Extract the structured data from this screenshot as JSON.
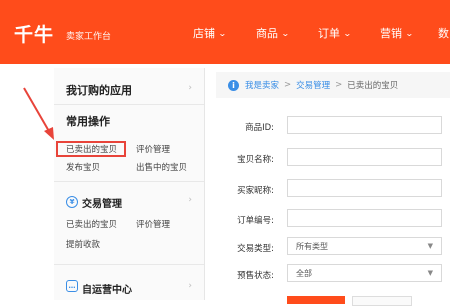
{
  "header": {
    "logo": "千牛",
    "subtitle": "卖家工作台",
    "nav": [
      {
        "label": "店铺"
      },
      {
        "label": "商品"
      },
      {
        "label": "订单"
      },
      {
        "label": "营销"
      },
      {
        "label": "数"
      }
    ]
  },
  "sidebar": {
    "my_apps": "我订购的应用",
    "common_ops": "常用操作",
    "common_links": [
      "已卖出的宝贝",
      "评价管理",
      "发布宝贝",
      "出售中的宝贝"
    ],
    "trade_mgmt": "交易管理",
    "trade_links": [
      "已卖出的宝贝",
      "评价管理",
      "提前收款"
    ],
    "self_center": "自运营中心"
  },
  "breadcrumb": [
    "我是卖家",
    "交易管理",
    "已卖出的宝贝"
  ],
  "form": {
    "product_id": "商品ID:",
    "product_name": "宝贝名称:",
    "buyer_nick": "买家昵称:",
    "order_no": "订单编号:",
    "trade_type": "交易类型:",
    "trade_type_value": "所有类型",
    "presale_status": "预售状态:",
    "presale_value": "全部"
  },
  "colors": {
    "brand": "#ff4c1b",
    "link": "#3a8ee6",
    "highlight": "#e8443a"
  }
}
